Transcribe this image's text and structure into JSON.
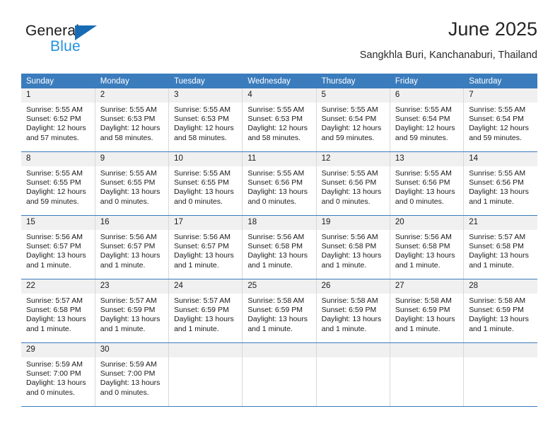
{
  "brand": {
    "name_top": "General",
    "name_bottom": "Blue",
    "triangle_color": "#176bb5",
    "blue_color": "#2491e0"
  },
  "header": {
    "title": "June 2025",
    "subtitle": "Sangkhla Buri, Kanchanaburi, Thailand"
  },
  "theme": {
    "header_bg": "#3b7cbd",
    "header_text": "#ffffff",
    "daynum_bg": "#f0f0f0",
    "grid_line": "#3b7cbd"
  },
  "weekday_headers": [
    "Sunday",
    "Monday",
    "Tuesday",
    "Wednesday",
    "Thursday",
    "Friday",
    "Saturday"
  ],
  "weeks": [
    [
      {
        "day": "1",
        "sunrise": "Sunrise: 5:55 AM",
        "sunset": "Sunset: 6:52 PM",
        "daylight": "Daylight: 12 hours and 57 minutes."
      },
      {
        "day": "2",
        "sunrise": "Sunrise: 5:55 AM",
        "sunset": "Sunset: 6:53 PM",
        "daylight": "Daylight: 12 hours and 58 minutes."
      },
      {
        "day": "3",
        "sunrise": "Sunrise: 5:55 AM",
        "sunset": "Sunset: 6:53 PM",
        "daylight": "Daylight: 12 hours and 58 minutes."
      },
      {
        "day": "4",
        "sunrise": "Sunrise: 5:55 AM",
        "sunset": "Sunset: 6:53 PM",
        "daylight": "Daylight: 12 hours and 58 minutes."
      },
      {
        "day": "5",
        "sunrise": "Sunrise: 5:55 AM",
        "sunset": "Sunset: 6:54 PM",
        "daylight": "Daylight: 12 hours and 59 minutes."
      },
      {
        "day": "6",
        "sunrise": "Sunrise: 5:55 AM",
        "sunset": "Sunset: 6:54 PM",
        "daylight": "Daylight: 12 hours and 59 minutes."
      },
      {
        "day": "7",
        "sunrise": "Sunrise: 5:55 AM",
        "sunset": "Sunset: 6:54 PM",
        "daylight": "Daylight: 12 hours and 59 minutes."
      }
    ],
    [
      {
        "day": "8",
        "sunrise": "Sunrise: 5:55 AM",
        "sunset": "Sunset: 6:55 PM",
        "daylight": "Daylight: 12 hours and 59 minutes."
      },
      {
        "day": "9",
        "sunrise": "Sunrise: 5:55 AM",
        "sunset": "Sunset: 6:55 PM",
        "daylight": "Daylight: 13 hours and 0 minutes."
      },
      {
        "day": "10",
        "sunrise": "Sunrise: 5:55 AM",
        "sunset": "Sunset: 6:55 PM",
        "daylight": "Daylight: 13 hours and 0 minutes."
      },
      {
        "day": "11",
        "sunrise": "Sunrise: 5:55 AM",
        "sunset": "Sunset: 6:56 PM",
        "daylight": "Daylight: 13 hours and 0 minutes."
      },
      {
        "day": "12",
        "sunrise": "Sunrise: 5:55 AM",
        "sunset": "Sunset: 6:56 PM",
        "daylight": "Daylight: 13 hours and 0 minutes."
      },
      {
        "day": "13",
        "sunrise": "Sunrise: 5:55 AM",
        "sunset": "Sunset: 6:56 PM",
        "daylight": "Daylight: 13 hours and 0 minutes."
      },
      {
        "day": "14",
        "sunrise": "Sunrise: 5:55 AM",
        "sunset": "Sunset: 6:56 PM",
        "daylight": "Daylight: 13 hours and 1 minute."
      }
    ],
    [
      {
        "day": "15",
        "sunrise": "Sunrise: 5:56 AM",
        "sunset": "Sunset: 6:57 PM",
        "daylight": "Daylight: 13 hours and 1 minute."
      },
      {
        "day": "16",
        "sunrise": "Sunrise: 5:56 AM",
        "sunset": "Sunset: 6:57 PM",
        "daylight": "Daylight: 13 hours and 1 minute."
      },
      {
        "day": "17",
        "sunrise": "Sunrise: 5:56 AM",
        "sunset": "Sunset: 6:57 PM",
        "daylight": "Daylight: 13 hours and 1 minute."
      },
      {
        "day": "18",
        "sunrise": "Sunrise: 5:56 AM",
        "sunset": "Sunset: 6:58 PM",
        "daylight": "Daylight: 13 hours and 1 minute."
      },
      {
        "day": "19",
        "sunrise": "Sunrise: 5:56 AM",
        "sunset": "Sunset: 6:58 PM",
        "daylight": "Daylight: 13 hours and 1 minute."
      },
      {
        "day": "20",
        "sunrise": "Sunrise: 5:56 AM",
        "sunset": "Sunset: 6:58 PM",
        "daylight": "Daylight: 13 hours and 1 minute."
      },
      {
        "day": "21",
        "sunrise": "Sunrise: 5:57 AM",
        "sunset": "Sunset: 6:58 PM",
        "daylight": "Daylight: 13 hours and 1 minute."
      }
    ],
    [
      {
        "day": "22",
        "sunrise": "Sunrise: 5:57 AM",
        "sunset": "Sunset: 6:58 PM",
        "daylight": "Daylight: 13 hours and 1 minute."
      },
      {
        "day": "23",
        "sunrise": "Sunrise: 5:57 AM",
        "sunset": "Sunset: 6:59 PM",
        "daylight": "Daylight: 13 hours and 1 minute."
      },
      {
        "day": "24",
        "sunrise": "Sunrise: 5:57 AM",
        "sunset": "Sunset: 6:59 PM",
        "daylight": "Daylight: 13 hours and 1 minute."
      },
      {
        "day": "25",
        "sunrise": "Sunrise: 5:58 AM",
        "sunset": "Sunset: 6:59 PM",
        "daylight": "Daylight: 13 hours and 1 minute."
      },
      {
        "day": "26",
        "sunrise": "Sunrise: 5:58 AM",
        "sunset": "Sunset: 6:59 PM",
        "daylight": "Daylight: 13 hours and 1 minute."
      },
      {
        "day": "27",
        "sunrise": "Sunrise: 5:58 AM",
        "sunset": "Sunset: 6:59 PM",
        "daylight": "Daylight: 13 hours and 1 minute."
      },
      {
        "day": "28",
        "sunrise": "Sunrise: 5:58 AM",
        "sunset": "Sunset: 6:59 PM",
        "daylight": "Daylight: 13 hours and 1 minute."
      }
    ],
    [
      {
        "day": "29",
        "sunrise": "Sunrise: 5:59 AM",
        "sunset": "Sunset: 7:00 PM",
        "daylight": "Daylight: 13 hours and 0 minutes."
      },
      {
        "day": "30",
        "sunrise": "Sunrise: 5:59 AM",
        "sunset": "Sunset: 7:00 PM",
        "daylight": "Daylight: 13 hours and 0 minutes."
      },
      {
        "day": "",
        "sunrise": "",
        "sunset": "",
        "daylight": ""
      },
      {
        "day": "",
        "sunrise": "",
        "sunset": "",
        "daylight": ""
      },
      {
        "day": "",
        "sunrise": "",
        "sunset": "",
        "daylight": ""
      },
      {
        "day": "",
        "sunrise": "",
        "sunset": "",
        "daylight": ""
      },
      {
        "day": "",
        "sunrise": "",
        "sunset": "",
        "daylight": ""
      }
    ]
  ]
}
